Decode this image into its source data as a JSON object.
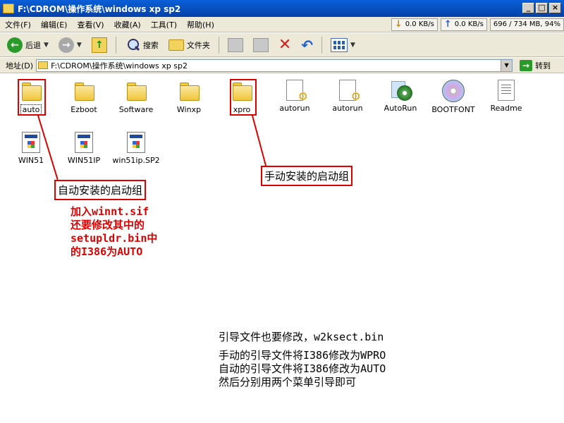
{
  "window": {
    "title": "F:\\CDROM\\操作系统\\windows xp sp2"
  },
  "menu": {
    "items": [
      "文件(F)",
      "编辑(E)",
      "查看(V)",
      "收藏(A)",
      "工具(T)",
      "帮助(H)"
    ],
    "net": {
      "down": "0.0 KB/s",
      "up": "0.0 KB/s",
      "memory": "696 / 734 MB, 94%"
    }
  },
  "toolbar": {
    "back_label": "后退",
    "search_label": "搜索",
    "folders_label": "文件夹"
  },
  "address": {
    "label": "地址(D)",
    "value": "F:\\CDROM\\操作系统\\windows xp sp2",
    "go_label": "转到"
  },
  "files": [
    {
      "name": "auto",
      "type": "folder"
    },
    {
      "name": "Ezboot",
      "type": "folder"
    },
    {
      "name": "Software",
      "type": "folder"
    },
    {
      "name": "Winxp",
      "type": "folder"
    },
    {
      "name": "xpro",
      "type": "folder"
    },
    {
      "name": "autorun",
      "type": "script"
    },
    {
      "name": "autorun",
      "type": "script"
    },
    {
      "name": "AutoRun",
      "type": "exe"
    },
    {
      "name": "BOOTFONT",
      "type": "disc"
    },
    {
      "name": "Readme",
      "type": "text"
    },
    {
      "name": "WIN51",
      "type": "system"
    },
    {
      "name": "WIN51IP",
      "type": "system"
    },
    {
      "name": "win51ip.SP2",
      "type": "system"
    }
  ],
  "annotations": {
    "auto_label": "自动安装的启动组",
    "manual_label": "手动安装的启动组",
    "red_note": [
      "加入winnt.sif",
      "还要修改其中的",
      "setupldr.bin中",
      "的I386为AUTO"
    ],
    "black_note": [
      "引导文件也要修改，w2ksect.bin",
      "",
      "手动的引导文件将I386修改为WPRO",
      "自动的引导文件将I386修改为AUTO",
      "然后分别用两个菜单引导即可"
    ]
  }
}
